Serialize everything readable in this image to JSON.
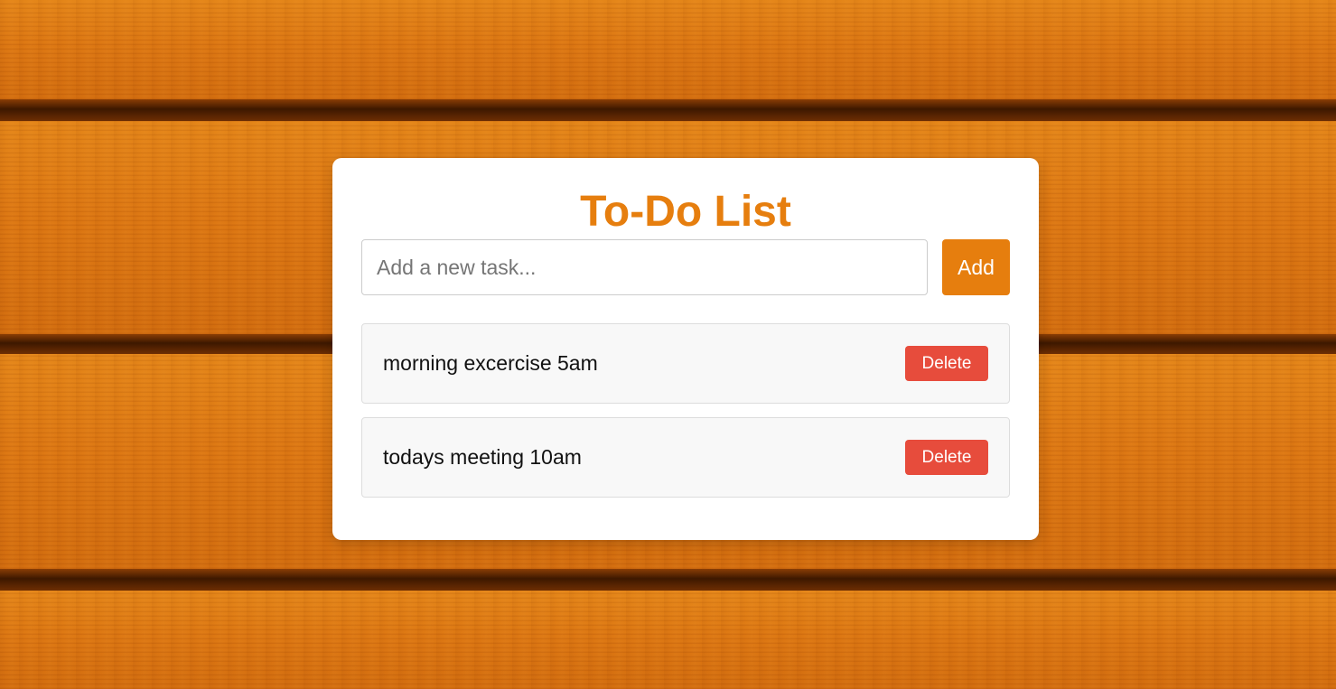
{
  "app": {
    "title": "To-Do List"
  },
  "input": {
    "placeholder": "Add a new task...",
    "value": ""
  },
  "add_button": {
    "label": "Add"
  },
  "tasks": [
    {
      "text": "morning excercise 5am",
      "delete_label": "Delete"
    },
    {
      "text": "todays meeting 10am",
      "delete_label": "Delete"
    }
  ],
  "colors": {
    "accent": "#e67e0e",
    "delete": "#e74c3c",
    "background_wood": "#d9700f",
    "card": "#ffffff"
  }
}
